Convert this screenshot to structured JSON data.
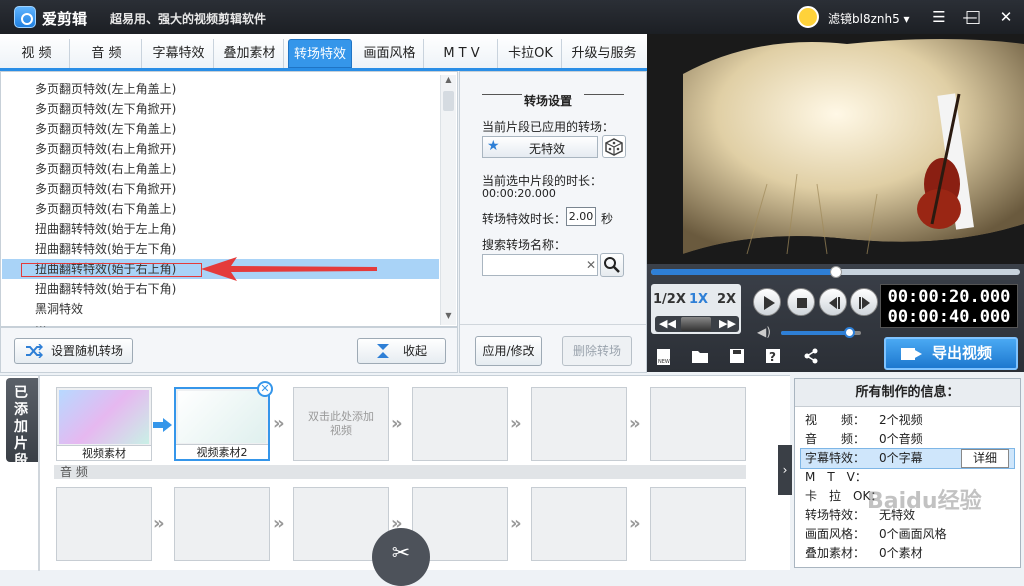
{
  "app": {
    "name": "爱剪辑",
    "slogan": "超易用、强大的视频剪辑软件",
    "username": "滤镜bl8znh5"
  },
  "window_controls": {
    "menu": "☰",
    "minimize": "—",
    "maximize": "□",
    "close": "✕"
  },
  "tabs": [
    "视 频",
    "音 频",
    "字幕特效",
    "叠加素材",
    "转场特效",
    "画面风格",
    "M T V",
    "卡拉OK",
    "升级与服务"
  ],
  "active_tab_index": 4,
  "transition_list": {
    "items": [
      "多页翻页特效(左上角盖上)",
      "多页翻页特效(左下角掀开)",
      "多页翻页特效(左下角盖上)",
      "多页翻页特效(右上角掀开)",
      "多页翻页特效(右上角盖上)",
      "多页翻页特效(右下角掀开)",
      "多页翻页特效(右下角盖上)",
      "扭曲翻转特效(始于左上角)",
      "扭曲翻转特效(始于左下角)",
      "扭曲翻转特效(始于右上角)",
      "扭曲翻转特效(始于右下角)",
      "黑洞特效",
      "..."
    ],
    "selected_index": 9,
    "random_button": "设置随机转场",
    "collapse_button": "收起"
  },
  "settings": {
    "title": "转场设置",
    "applied_label": "当前片段已应用的转场：",
    "applied_value": "无特效",
    "selected_duration_label": "当前选中片段的时长：",
    "selected_duration_value": "00:00:20.000",
    "effect_duration_label": "转场特效时长：",
    "effect_duration_value": "2.00",
    "effect_duration_unit": "秒",
    "search_label": "搜索转场名称：",
    "search_clear": "✕",
    "apply_button": "应用/修改",
    "delete_button": "删除转场"
  },
  "player": {
    "progress": 0.5,
    "speeds": [
      "1/2X",
      "1X",
      "2X"
    ],
    "active_speed_index": 1,
    "time_current": "00:00:20.000",
    "time_total": "00:00:40.000",
    "volume": 0.85,
    "export_button": "导出视频"
  },
  "timeline": {
    "added_tab": "已添加片段",
    "clips": [
      "视频素材",
      "视频素材2"
    ],
    "empty_hint": "双击此处添加视频",
    "audio_label": "音 频"
  },
  "info": {
    "title": "所有制作的信息：",
    "rows": [
      {
        "k": "视　　频：",
        "v": "2个视频"
      },
      {
        "k": "音　　频：",
        "v": "0个音频"
      },
      {
        "k": "字幕特效：",
        "v": "0个字幕"
      },
      {
        "k": "M　T　V：",
        "v": ""
      },
      {
        "k": "卡　拉　OK：",
        "v": ""
      },
      {
        "k": "转场特效：",
        "v": "无特效"
      },
      {
        "k": "画面风格：",
        "v": "0个画面风格"
      },
      {
        "k": "叠加素材：",
        "v": "0个素材"
      }
    ],
    "detail_button": "详细"
  },
  "watermark": "Baidu经验",
  "colors": {
    "accent": "#2a8ee6",
    "selection": "#a9d3f7",
    "arrow": "#e43b3b"
  }
}
